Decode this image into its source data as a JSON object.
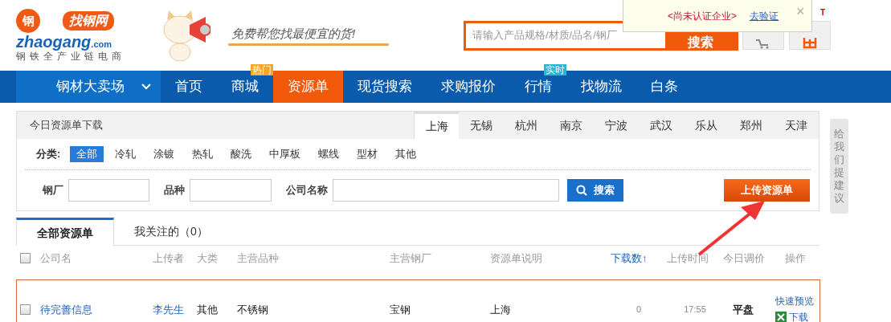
{
  "header": {
    "logo": {
      "badge": "钢",
      "bubble": "找钢网",
      "domain": "zhaogang",
      "domain_suffix": ".com",
      "tagline": "钢铁全产业链电商"
    },
    "slogan": "免费帮您找最便宜的货!",
    "search": {
      "placeholder": "请输入产品规格/材质/品名/钢厂",
      "button": "搜索"
    },
    "corner_text": "T"
  },
  "notice": {
    "text": "<尚未认证企业>",
    "link": "去验证",
    "close": "×"
  },
  "nav": {
    "category_menu": "钢材大卖场",
    "items": [
      {
        "label": "首页",
        "selected": false
      },
      {
        "label": "商城",
        "selected": false,
        "badge": "热门",
        "color": "#f5a623"
      },
      {
        "label": "资源单",
        "selected": true
      },
      {
        "label": "现货搜索",
        "selected": false
      },
      {
        "label": "求购报价",
        "selected": false
      },
      {
        "label": "行情",
        "selected": false,
        "badge": "实时",
        "color": "#27b5d8"
      },
      {
        "label": "找物流",
        "selected": false
      },
      {
        "label": "白条",
        "selected": false
      }
    ]
  },
  "panel": {
    "title": "今日资源单下载",
    "cities": [
      {
        "label": "上海",
        "selected": true
      },
      {
        "label": "无锡",
        "selected": false
      },
      {
        "label": "杭州",
        "selected": false
      },
      {
        "label": "南京",
        "selected": false
      },
      {
        "label": "宁波",
        "selected": false
      },
      {
        "label": "武汉",
        "selected": false
      },
      {
        "label": "乐从",
        "selected": false
      },
      {
        "label": "郑州",
        "selected": false
      },
      {
        "label": "天津",
        "selected": false
      }
    ],
    "category_label": "分类:",
    "categories": [
      {
        "label": "全部",
        "selected": true
      },
      {
        "label": "冷轧",
        "selected": false
      },
      {
        "label": "涂镀",
        "selected": false
      },
      {
        "label": "热轧",
        "selected": false
      },
      {
        "label": "酸洗",
        "selected": false
      },
      {
        "label": "中厚板",
        "selected": false
      },
      {
        "label": "螺线",
        "selected": false
      },
      {
        "label": "型材",
        "selected": false
      },
      {
        "label": "其他",
        "selected": false
      }
    ],
    "filters": [
      {
        "label": "钢厂"
      },
      {
        "label": "品种"
      },
      {
        "label": "公司名称"
      }
    ],
    "search_button": "搜索",
    "upload_button": "上传资源单"
  },
  "feedback": "给我们提建议",
  "list_tabs": [
    {
      "label": "全部资源单",
      "selected": true
    },
    {
      "label": "我关注的（0）",
      "selected": false
    }
  ],
  "table": {
    "header_checked": false,
    "columns": [
      {
        "label": "公司名",
        "active": false
      },
      {
        "label": "上传者",
        "active": false
      },
      {
        "label": "大类",
        "active": false
      },
      {
        "label": "主营品种",
        "active": false
      },
      {
        "label": "主营钢厂",
        "active": false
      },
      {
        "label": "资源单说明",
        "active": false
      },
      {
        "label": "下载数↑",
        "active": true
      },
      {
        "label": "上传时间",
        "active": false
      },
      {
        "label": "今日调价",
        "active": false
      },
      {
        "label": "操作",
        "active": false
      }
    ],
    "rows": [
      {
        "checked": false,
        "company": "待完善信息",
        "uploader": "李先生",
        "category": "其他",
        "product": "不锈钢",
        "mill": "宝钢",
        "note": "上海",
        "downloads": "0",
        "time": "17:55",
        "price_change": "平盘",
        "actions": [
          "快速预览",
          "下载"
        ]
      }
    ]
  }
}
